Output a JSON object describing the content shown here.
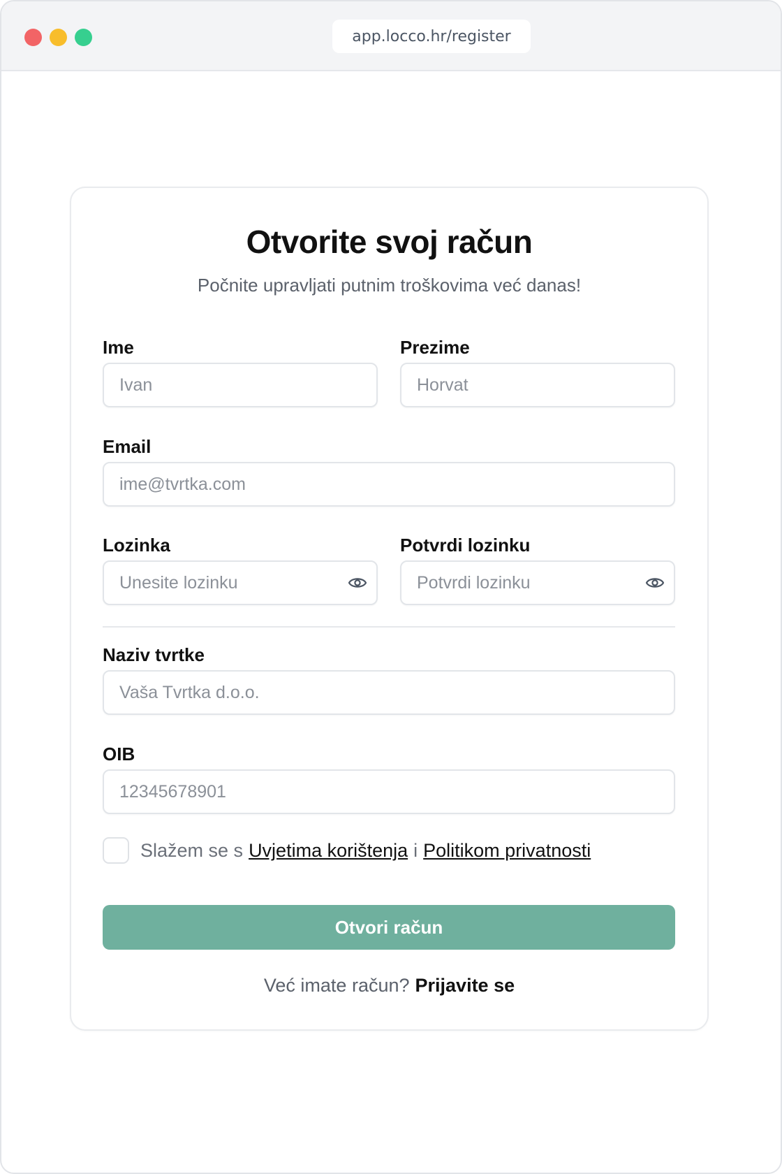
{
  "browser": {
    "url": "app.locco.hr/register"
  },
  "form": {
    "title": "Otvorite svoj račun",
    "subtitle": "Počnite upravljati putnim troškovima već danas!",
    "first_name": {
      "label": "Ime",
      "placeholder": "Ivan",
      "value": ""
    },
    "last_name": {
      "label": "Prezime",
      "placeholder": "Horvat",
      "value": ""
    },
    "email": {
      "label": "Email",
      "placeholder": "ime@tvrtka.com",
      "value": ""
    },
    "password": {
      "label": "Lozinka",
      "placeholder": "Unesite lozinku",
      "value": "",
      "icon": "eye-icon"
    },
    "confirm_password": {
      "label": "Potvrdi lozinku",
      "placeholder": "Potvrdi lozinku",
      "value": "",
      "icon": "eye-icon"
    },
    "company": {
      "label": "Naziv tvrtke",
      "placeholder": "Vaša Tvrtka d.o.o.",
      "value": ""
    },
    "oib": {
      "label": "OIB",
      "placeholder": "12345678901",
      "value": ""
    },
    "terms": {
      "checked": false,
      "prefix": "Slažem se s",
      "terms_link": "Uvjetima korištenja",
      "joiner": "i",
      "privacy_link": "Politikom privatnosti"
    },
    "submit_label": "Otvori račun",
    "login_prompt": "Već imate račun?",
    "login_link": "Prijavite se"
  },
  "colors": {
    "accent": "#6fb09e",
    "window_red": "#f26466",
    "window_yellow": "#f8bd2b",
    "window_green": "#36cf8f"
  }
}
